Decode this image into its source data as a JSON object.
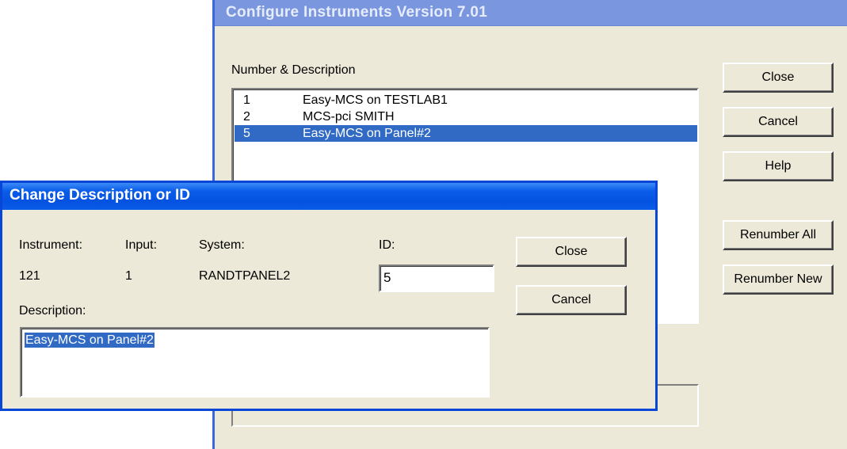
{
  "configure_window": {
    "title": "Configure Instruments Version 7.01",
    "list_label": "Number & Description",
    "instruments": [
      {
        "number": "1",
        "description": "Easy-MCS on TESTLAB1",
        "selected": false
      },
      {
        "number": "2",
        "description": "MCS-pci SMITH",
        "selected": false
      },
      {
        "number": "5",
        "description": "Easy-MCS on Panel#2",
        "selected": true
      }
    ],
    "buttons": {
      "close": "Close",
      "cancel": "Cancel",
      "help": "Help",
      "renumber_all": "Renumber All",
      "renumber_new": "Renumber New"
    }
  },
  "change_dialog": {
    "title": "Change Description or ID",
    "instrument_label": "Instrument:",
    "instrument_value": "121",
    "input_label": "Input:",
    "input_value": "1",
    "system_label": "System:",
    "system_value": "RANDTPANEL2",
    "id_label": "ID:",
    "id_value": "5",
    "description_label": "Description:",
    "description_value": "Easy-MCS on Panel#2",
    "buttons": {
      "close": "Close",
      "cancel": "Cancel"
    }
  },
  "colors": {
    "selection": "#316ac5",
    "dialog_title_active": "#0a5de8",
    "window_title_inactive": "#7a96df",
    "face": "#ece9d8"
  }
}
